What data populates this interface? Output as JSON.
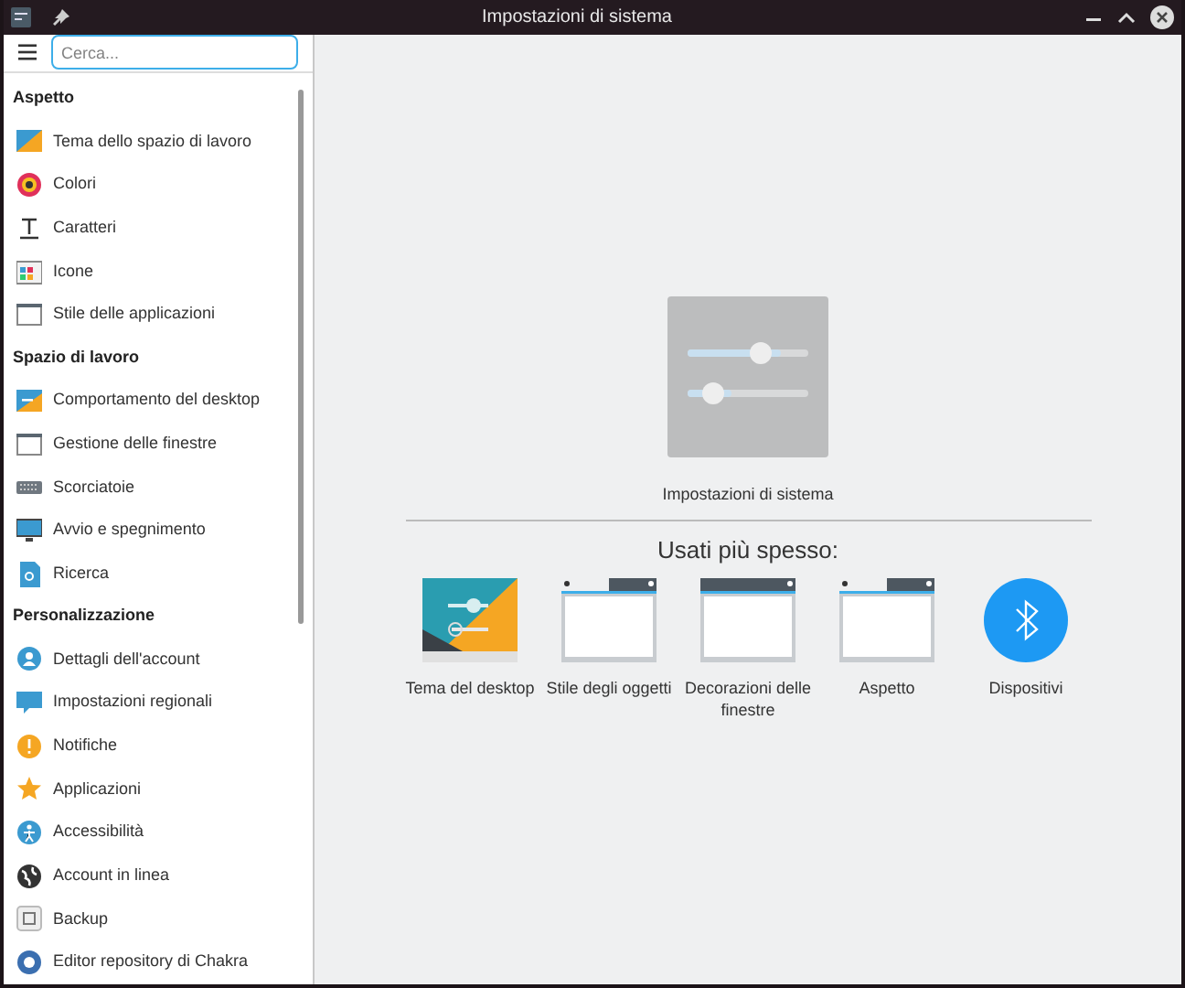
{
  "window": {
    "title": "Impostazioni di sistema"
  },
  "search": {
    "placeholder": "Cerca..."
  },
  "sidebar": {
    "sections": [
      {
        "title": "Aspetto",
        "items": [
          {
            "label": "Tema dello spazio di lavoro"
          },
          {
            "label": "Colori"
          },
          {
            "label": "Caratteri"
          },
          {
            "label": "Icone"
          },
          {
            "label": "Stile delle applicazioni"
          }
        ]
      },
      {
        "title": "Spazio di lavoro",
        "items": [
          {
            "label": "Comportamento del desktop"
          },
          {
            "label": "Gestione delle finestre"
          },
          {
            "label": "Scorciatoie"
          },
          {
            "label": "Avvio e spegnimento"
          },
          {
            "label": "Ricerca"
          }
        ]
      },
      {
        "title": "Personalizzazione",
        "items": [
          {
            "label": "Dettagli dell'account"
          },
          {
            "label": "Impostazioni regionali"
          },
          {
            "label": "Notifiche"
          },
          {
            "label": "Applicazioni"
          },
          {
            "label": "Accessibilità"
          },
          {
            "label": "Account in linea"
          },
          {
            "label": "Backup"
          },
          {
            "label": "Editor repository di Chakra"
          }
        ]
      }
    ]
  },
  "main": {
    "app_label": "Impostazioni di sistema",
    "heading": "Usati più spesso:",
    "frequent": [
      {
        "label": "Tema del desktop",
        "kind": "theme"
      },
      {
        "label": "Stile degli oggetti",
        "kind": "window"
      },
      {
        "label": "Decorazioni delle finestre",
        "kind": "decor"
      },
      {
        "label": "Aspetto",
        "kind": "window"
      },
      {
        "label": "Dispositivi",
        "kind": "bluetooth"
      }
    ]
  }
}
